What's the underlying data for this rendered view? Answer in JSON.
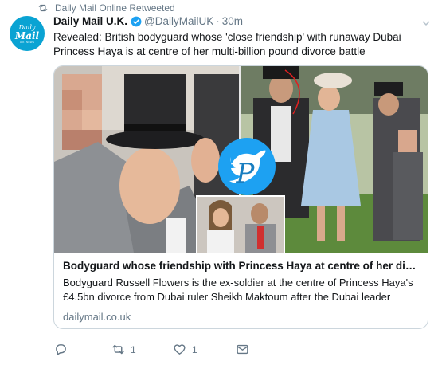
{
  "retweet_context": "Daily Mail Online Retweeted",
  "avatar": {
    "line1": "Daily",
    "line2": "Mail",
    "line3": "U.K. NEWS"
  },
  "author": {
    "name": "Daily Mail U.K.",
    "handle": "@DailyMailUK",
    "separator": "·",
    "time": "30m"
  },
  "tweet_text": "Revealed: British bodyguard whose 'close friendship' with runaway Dubai Princess Haya is at centre of her multi-billion pound divorce battle",
  "card": {
    "title": "Bodyguard whose friendship with Princess Haya at centre of her divo...",
    "description": "Bodyguard Russell Flowers is the ex-soldier at the centre of Princess Haya's £4.5bn divorce from Dubai ruler Sheikh Maktoum after the Dubai leader",
    "domain": "dailymail.co.uk",
    "watermark_letter": "P"
  },
  "actions": {
    "reply_count": "",
    "retweet_count": "1",
    "like_count": "1"
  },
  "icons": {
    "retweet_context": "retweet-icon",
    "verified": "verified-badge-icon",
    "caret": "chevron-down-icon",
    "reply": "reply-icon",
    "retweet": "retweet-icon",
    "like": "heart-icon",
    "dm": "envelope-icon"
  },
  "colors": {
    "brand_blue": "#1da1f2",
    "text": "#14171a",
    "muted": "#657786",
    "avatar_bg": "#0aa3d3"
  }
}
